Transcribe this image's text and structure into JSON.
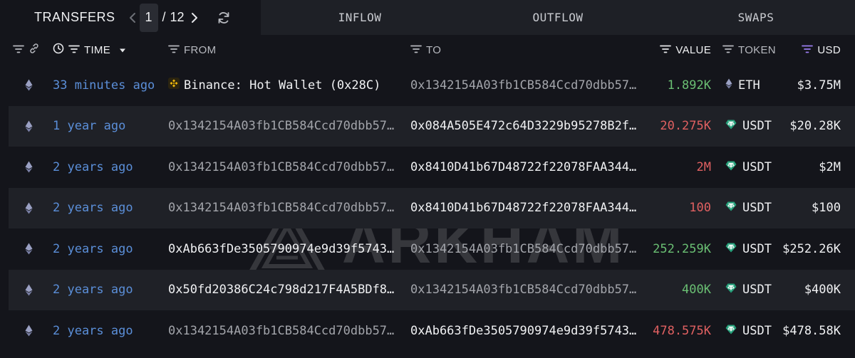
{
  "tabs": {
    "active": "TRANSFERS",
    "page_current": "1",
    "page_separator": "/",
    "page_total": "12",
    "inflow": "INFLOW",
    "outflow": "OUTFLOW",
    "swaps": "SWAPS"
  },
  "columns": {
    "time": "TIME",
    "from": "FROM",
    "to": "TO",
    "value": "VALUE",
    "token": "TOKEN",
    "usd": "USD"
  },
  "colors": {
    "time_link": "#5b8fd9",
    "value_in": "#6abf73",
    "value_out": "#e06061",
    "usdt": "#26a17b",
    "binance": "#f0b90b"
  },
  "rows": [
    {
      "time": "33 minutes ago",
      "from": "Binance: Hot Wallet (0x28C)",
      "from_icon": "binance-icon",
      "to": "0x1342154A03fb1CB584Ccd70dbb57…",
      "value": "1.892K",
      "direction": "in",
      "token": "ETH",
      "token_icon": "eth-icon",
      "usd": "$3.75M"
    },
    {
      "time": "1 year ago",
      "from": "0x1342154A03fb1CB584Ccd70dbb57…",
      "to": "0x084A505E472c64D3229b95278B2f…",
      "value": "20.275K",
      "direction": "out",
      "token": "USDT",
      "token_icon": "usdt-icon",
      "usd": "$20.28K"
    },
    {
      "time": "2 years ago",
      "from": "0x1342154A03fb1CB584Ccd70dbb57…",
      "to": "0x8410D41b67D48722f22078FAA344…",
      "value": "2M",
      "direction": "out",
      "token": "USDT",
      "token_icon": "usdt-icon",
      "usd": "$2M"
    },
    {
      "time": "2 years ago",
      "from": "0x1342154A03fb1CB584Ccd70dbb57…",
      "to": "0x8410D41b67D48722f22078FAA344…",
      "value": "100",
      "direction": "out",
      "token": "USDT",
      "token_icon": "usdt-icon",
      "usd": "$100"
    },
    {
      "time": "2 years ago",
      "from": "0xAb663fDe3505790974e9d39f5743…",
      "to": "0x1342154A03fb1CB584Ccd70dbb57…",
      "value": "252.259K",
      "direction": "in",
      "token": "USDT",
      "token_icon": "usdt-icon",
      "usd": "$252.26K"
    },
    {
      "time": "2 years ago",
      "from": "0x50fd20386C24c798d217F4A5BDf8…",
      "to": "0x1342154A03fb1CB584Ccd70dbb57…",
      "value": "400K",
      "direction": "in",
      "token": "USDT",
      "token_icon": "usdt-icon",
      "usd": "$400K"
    },
    {
      "time": "2 years ago",
      "from": "0x1342154A03fb1CB584Ccd70dbb57…",
      "to": "0xAb663fDe3505790974e9d39f5743…",
      "value": "478.575K",
      "direction": "out",
      "token": "USDT",
      "token_icon": "usdt-icon",
      "usd": "$478.58K"
    }
  ],
  "watermark": "ARKHAM"
}
